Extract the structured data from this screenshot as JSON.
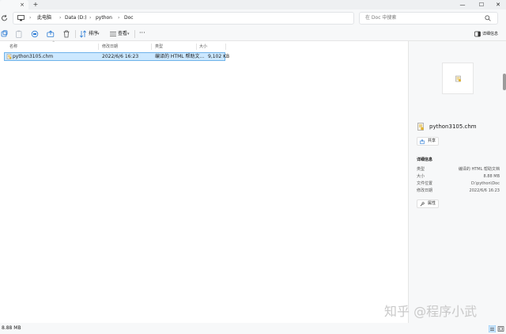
{
  "window": {
    "tab_close": "×",
    "tab_new": "+",
    "minimize": "—",
    "maximize": "☐",
    "close": "✕"
  },
  "address": {
    "breadcrumbs": [
      "此电脑",
      "Data (D:)",
      "python",
      "Doc"
    ],
    "separator": "›",
    "search_placeholder": "在 Doc 中搜索"
  },
  "toolbar": {
    "sort_label": "排序",
    "view_label": "查看",
    "more_label": "···",
    "details_label": "详细信息"
  },
  "columns": {
    "name": "名称",
    "modified": "修改日期",
    "type": "类型",
    "size": "大小"
  },
  "files": [
    {
      "name": "python3105.chm",
      "modified": "2022/6/6 16:23",
      "type": "编译的 HTML 帮助文...",
      "size": "9,102 KB"
    }
  ],
  "details": {
    "filename": "python3105.chm",
    "share_label": "共享",
    "section_title": "详细信息",
    "rows": [
      {
        "key": "类型",
        "value": "编译的 HTML 帮助文档"
      },
      {
        "key": "大小",
        "value": "8.88 MB"
      },
      {
        "key": "文件位置",
        "value": "D:\\python\\Doc"
      },
      {
        "key": "修改日期",
        "value": "2022/6/6 16:23"
      }
    ],
    "properties_label": "属性"
  },
  "status": {
    "selection_size": "8.88 MB"
  },
  "watermark": "知乎 @程序小武",
  "colors": {
    "selection_fill": "#cce8ff",
    "selection_border": "#6fb3ea",
    "chrome_bg": "#f7f8f9",
    "chm_icon": "#e3b22b"
  }
}
